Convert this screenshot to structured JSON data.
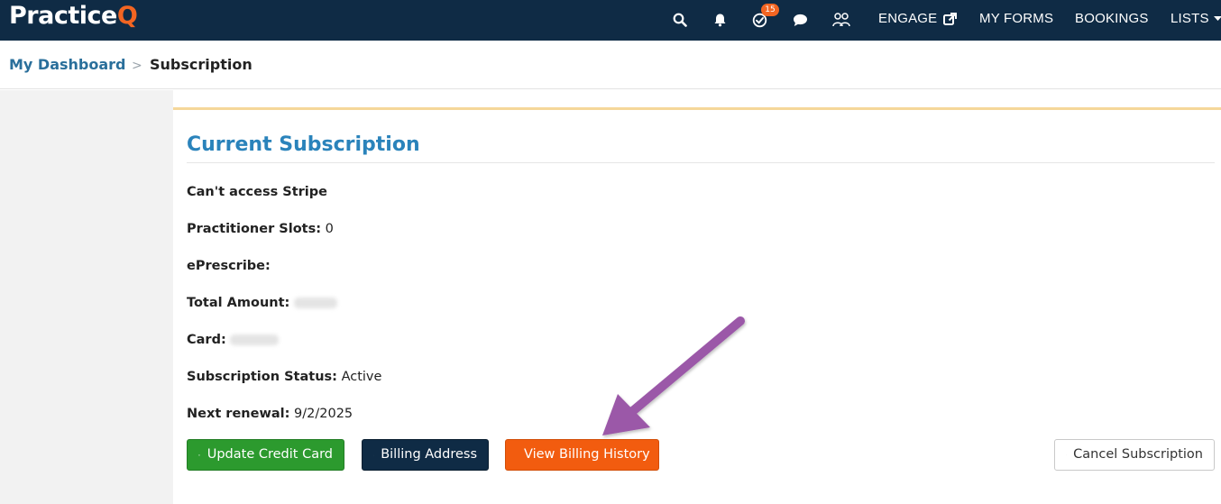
{
  "app": {
    "logo_main": "Practice",
    "logo_q": "Q"
  },
  "navbar": {
    "badge_count": "15",
    "links": {
      "engage": "ENGAGE",
      "my_forms": "MY FORMS",
      "bookings": "BOOKINGS",
      "lists": "LISTS"
    }
  },
  "breadcrumb": {
    "home": "My Dashboard",
    "separator": ">",
    "current": "Subscription"
  },
  "subscription": {
    "title": "Current Subscription",
    "stripe_notice": "Can't access Stripe",
    "practitioner_slots_label": "Practitioner Slots:",
    "practitioner_slots_value": "0",
    "eprescribe_label": "ePrescribe:",
    "eprescribe_value": "",
    "total_amount_label": "Total Amount:",
    "card_label": "Card:",
    "status_label": "Subscription Status:",
    "status_value": "Active",
    "next_renewal_label": "Next renewal:",
    "next_renewal_value": "9/2/2025"
  },
  "actions": {
    "update_card": "Update Credit Card",
    "billing_address": "Billing Address",
    "view_billing_history": "View Billing History",
    "cancel_subscription": "Cancel Subscription"
  },
  "colors": {
    "navbar": "#0f2b45",
    "accent_orange": "#f25c0f",
    "title_blue": "#2a83bb",
    "green": "#2c9a2e",
    "annotation_arrow": "#9b59a8"
  },
  "icons": {
    "search": "search-icon",
    "bell": "bell-icon",
    "tasks": "check-circle-icon",
    "chat": "chat-bubble-icon",
    "team": "people-icon",
    "external": "external-link-icon",
    "caret": "caret-down-icon",
    "card": "credit-card-icon",
    "pin": "map-pin-icon",
    "list": "list-icon",
    "warning": "warning-icon"
  }
}
